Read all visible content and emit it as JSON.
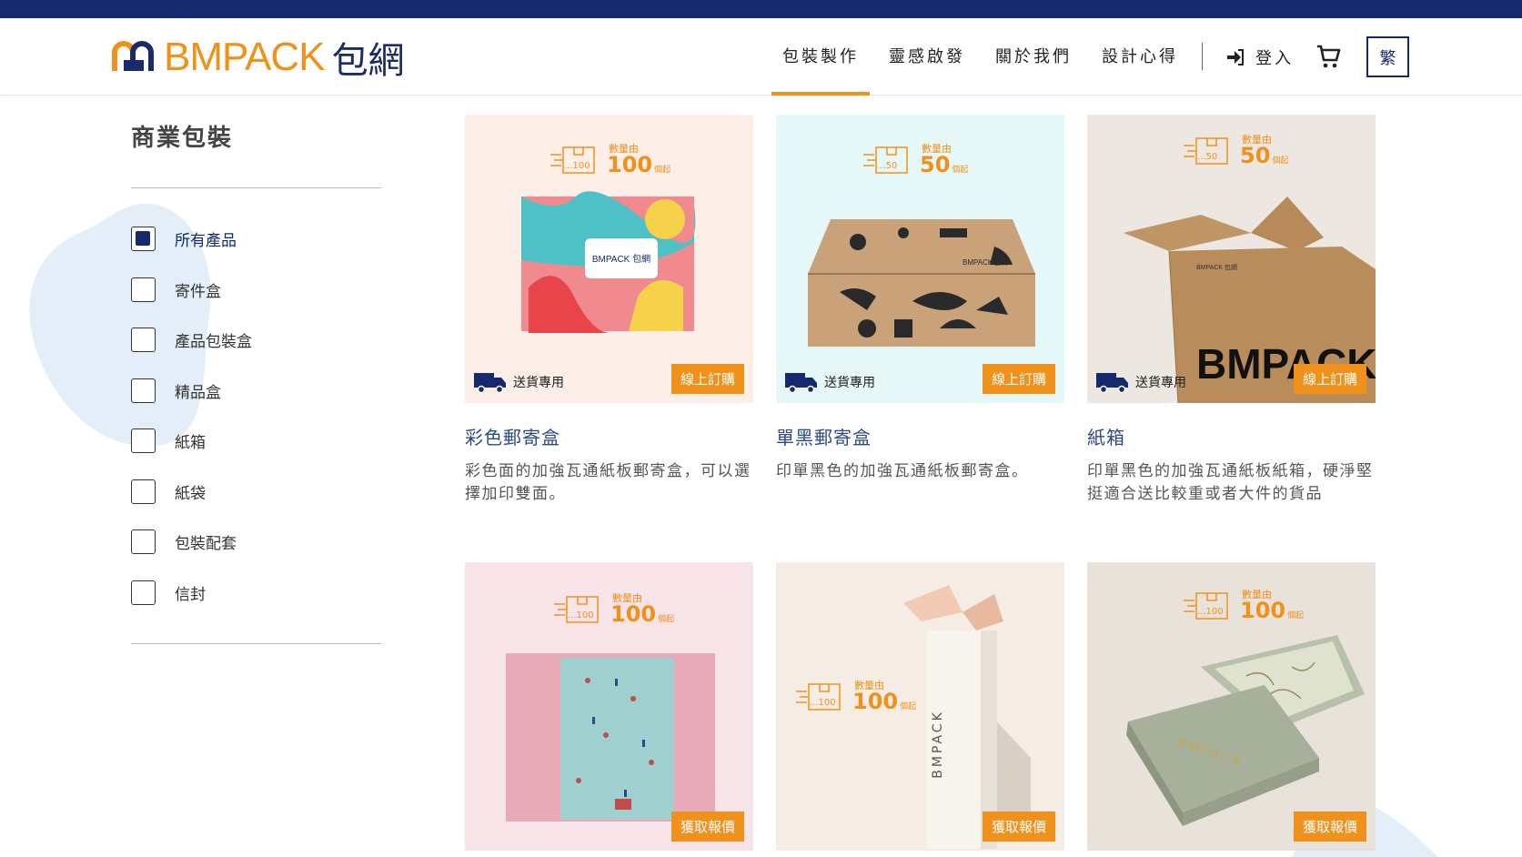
{
  "brand": {
    "logo_text": "BMPACK",
    "logo_cn": "包網"
  },
  "nav": {
    "items": [
      {
        "label": "包裝製作"
      },
      {
        "label": "靈感啟發"
      },
      {
        "label": "關於我們"
      },
      {
        "label": "設計心得"
      }
    ],
    "login_label": "登入",
    "lang_label": "繁"
  },
  "sidebar": {
    "title": "商業包裝",
    "categories": [
      {
        "label": "所有產品",
        "checked": true
      },
      {
        "label": "寄件盒",
        "checked": false
      },
      {
        "label": "產品包裝盒",
        "checked": false
      },
      {
        "label": "精品盒",
        "checked": false
      },
      {
        "label": "紙箱",
        "checked": false
      },
      {
        "label": "紙袋",
        "checked": false
      },
      {
        "label": "包裝配套",
        "checked": false
      },
      {
        "label": "信封",
        "checked": false
      }
    ]
  },
  "products": [
    {
      "qty_label": "數量由",
      "qty_small": "...100",
      "qty_num": "100",
      "qty_unit": "個起",
      "delivery": "送貨專用",
      "button": "線上訂購",
      "name": "彩色郵寄盒",
      "desc": "彩色面的加強瓦通紙板郵寄盒，可以選擇加印雙面。"
    },
    {
      "qty_label": "數量由",
      "qty_small": "...50",
      "qty_num": "50",
      "qty_unit": "個起",
      "delivery": "送貨專用",
      "button": "線上訂購",
      "name": "單黑郵寄盒",
      "desc": "印單黑色的加強瓦通紙板郵寄盒。"
    },
    {
      "qty_label": "數量由",
      "qty_small": "...50",
      "qty_num": "50",
      "qty_unit": "個起",
      "delivery": "送貨專用",
      "button": "線上訂購",
      "name": "紙箱",
      "desc": "印單黑色的加強瓦通紙板紙箱，硬淨堅挺適合送比較重或者大件的貨品"
    },
    {
      "qty_label": "數量由",
      "qty_small": "...100",
      "qty_num": "100",
      "qty_unit": "個起",
      "button": "獲取報價"
    },
    {
      "qty_label": "數量由",
      "qty_small": "...100",
      "qty_num": "100",
      "qty_unit": "個起",
      "button": "獲取報價",
      "print": "BMPACK"
    },
    {
      "qty_label": "數量由",
      "qty_small": "...100",
      "qty_num": "100",
      "qty_unit": "個起",
      "button": "獲取報價",
      "print": "BMPACK"
    }
  ],
  "colors": {
    "navy": "#15296e",
    "orange": "#f0911c",
    "blob": "#e3eef8"
  }
}
